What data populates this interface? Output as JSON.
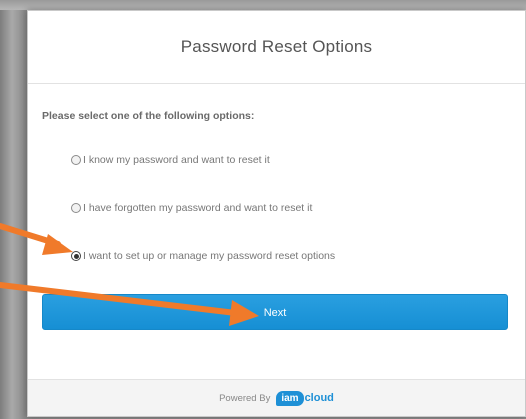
{
  "dialog": {
    "title": "Password Reset Options",
    "prompt": "Please select one of the following options:",
    "options": [
      {
        "label": "I know my password and want to reset it",
        "selected": false
      },
      {
        "label": "I have forgotten my password and want to reset it",
        "selected": false
      },
      {
        "label": "I want to set up or manage my password reset options",
        "selected": true
      }
    ],
    "next_label": "Next",
    "footer": {
      "powered_by": "Powered By",
      "logo_iam": "iam",
      "logo_cloud": "cloud"
    }
  },
  "colors": {
    "button": "#168fd4",
    "arrow": "#f07a2a",
    "logo": "#1e90d6"
  }
}
